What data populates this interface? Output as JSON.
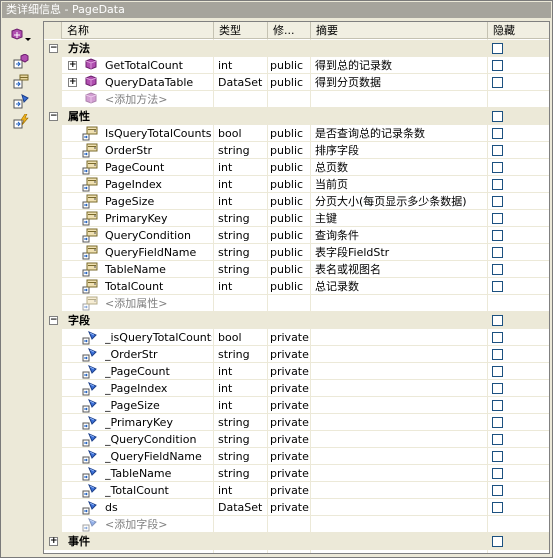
{
  "window": {
    "title": "类详细信息 - PageData"
  },
  "toolbar": {
    "items": [
      "add-member-icon",
      "properties-icon",
      "method-view-icon",
      "field-view-icon",
      "event-view-icon"
    ]
  },
  "columns": {
    "name": "名称",
    "type": "类型",
    "modifier": "修...",
    "summary": "摘要",
    "hidden": "隐藏"
  },
  "sections": [
    {
      "label": "方法",
      "expanded": true,
      "members": [
        {
          "name": "GetTotalCount",
          "type": "int",
          "modifier": "public",
          "summary": "得到总的记录数",
          "expandable": true,
          "kind": "method"
        },
        {
          "name": "QueryDataTable",
          "type": "DataSet",
          "modifier": "public",
          "summary": "得到分页数据",
          "expandable": true,
          "kind": "method"
        }
      ],
      "add_label": "<添加方法>"
    },
    {
      "label": "属性",
      "expanded": true,
      "members": [
        {
          "name": "IsQueryTotalCounts",
          "type": "bool",
          "modifier": "public",
          "summary": "是否查询总的记录条数",
          "kind": "property"
        },
        {
          "name": "OrderStr",
          "type": "string",
          "modifier": "public",
          "summary": "排序字段",
          "kind": "property"
        },
        {
          "name": "PageCount",
          "type": "int",
          "modifier": "public",
          "summary": "总页数",
          "kind": "property"
        },
        {
          "name": "PageIndex",
          "type": "int",
          "modifier": "public",
          "summary": "当前页",
          "kind": "property"
        },
        {
          "name": "PageSize",
          "type": "int",
          "modifier": "public",
          "summary": "分页大小(每页显示多少条数据)",
          "kind": "property"
        },
        {
          "name": "PrimaryKey",
          "type": "string",
          "modifier": "public",
          "summary": "主键",
          "kind": "property"
        },
        {
          "name": "QueryCondition",
          "type": "string",
          "modifier": "public",
          "summary": "查询条件",
          "kind": "property"
        },
        {
          "name": "QueryFieldName",
          "type": "string",
          "modifier": "public",
          "summary": "表字段FieldStr",
          "kind": "property"
        },
        {
          "name": "TableName",
          "type": "string",
          "modifier": "public",
          "summary": "表名或视图名",
          "kind": "property"
        },
        {
          "name": "TotalCount",
          "type": "int",
          "modifier": "public",
          "summary": "总记录数",
          "kind": "property"
        }
      ],
      "add_label": "<添加属性>"
    },
    {
      "label": "字段",
      "expanded": true,
      "members": [
        {
          "name": "_isQueryTotalCounts",
          "type": "bool",
          "modifier": "private",
          "summary": "",
          "kind": "field"
        },
        {
          "name": "_OrderStr",
          "type": "string",
          "modifier": "private",
          "summary": "",
          "kind": "field"
        },
        {
          "name": "_PageCount",
          "type": "int",
          "modifier": "private",
          "summary": "",
          "kind": "field"
        },
        {
          "name": "_PageIndex",
          "type": "int",
          "modifier": "private",
          "summary": "",
          "kind": "field"
        },
        {
          "name": "_PageSize",
          "type": "int",
          "modifier": "private",
          "summary": "",
          "kind": "field"
        },
        {
          "name": "_PrimaryKey",
          "type": "string",
          "modifier": "private",
          "summary": "",
          "kind": "field"
        },
        {
          "name": "_QueryCondition",
          "type": "string",
          "modifier": "private",
          "summary": "",
          "kind": "field"
        },
        {
          "name": "_QueryFieldName",
          "type": "string",
          "modifier": "private",
          "summary": "",
          "kind": "field"
        },
        {
          "name": "_TableName",
          "type": "string",
          "modifier": "private",
          "summary": "",
          "kind": "field"
        },
        {
          "name": "_TotalCount",
          "type": "int",
          "modifier": "private",
          "summary": "",
          "kind": "field"
        },
        {
          "name": "ds",
          "type": "DataSet",
          "modifier": "private",
          "summary": "",
          "kind": "field"
        }
      ],
      "add_label": "<添加字段>"
    },
    {
      "label": "事件",
      "expanded": false,
      "members": [],
      "add_label": ""
    }
  ],
  "colors": {
    "title_bg": "#a6a49c",
    "section_bg": "#ece9d8",
    "header_bg": "#f1efe2"
  }
}
